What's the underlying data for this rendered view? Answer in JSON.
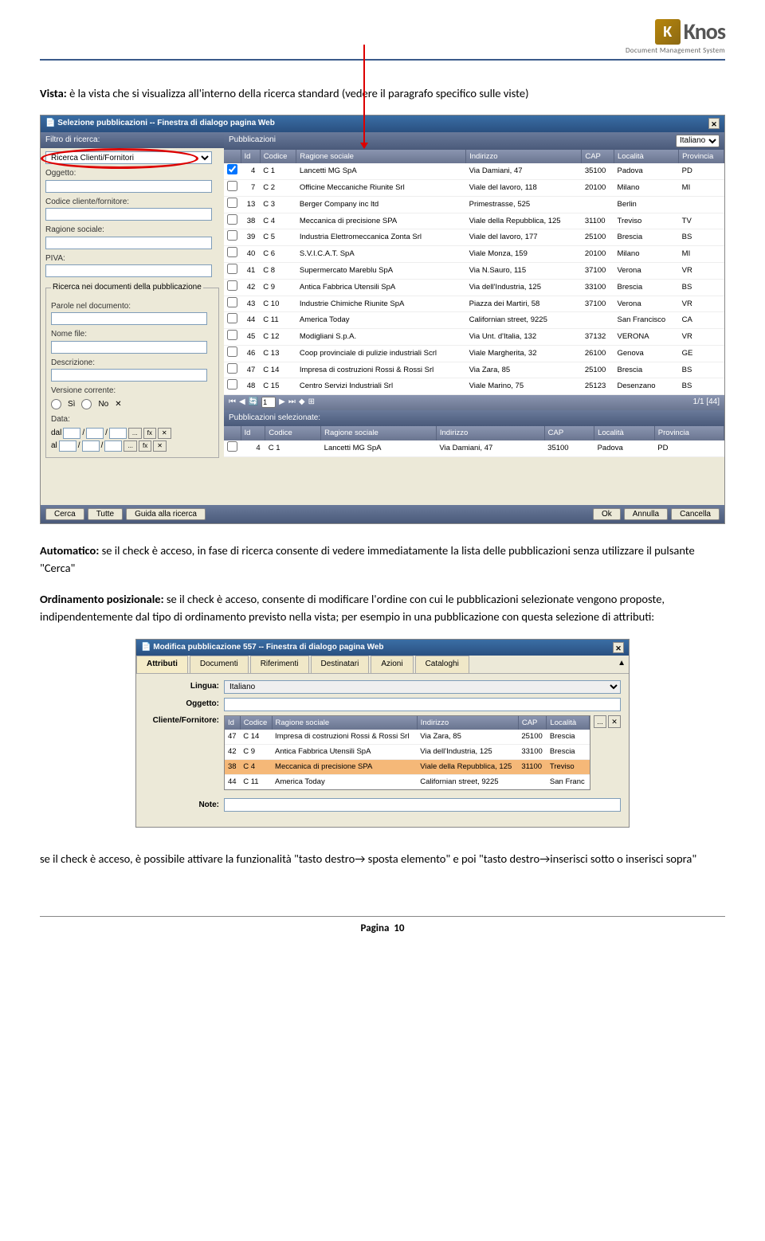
{
  "logo": {
    "brand": "Knos",
    "k": "K",
    "sub": "Document Management System"
  },
  "para1": {
    "label": "Vista:",
    "text": " è la vista che si visualizza all'interno della ricerca standard (vedere il paragrafo specifico sulle viste)"
  },
  "dlg1": {
    "title": "Selezione pubblicazioni -- Finestra di dialogo pagina Web",
    "filter_label": "Filtro di ricerca:",
    "dropdown_value": "Ricerca Clienti/Fornitori",
    "labels": {
      "oggetto": "Oggetto:",
      "codice": "Codice cliente/fornitore:",
      "ragione": "Ragione sociale:",
      "piva": "PIVA:",
      "fieldset": "Ricerca nei documenti della pubblicazione",
      "parole": "Parole nel documento:",
      "nomefile": "Nome file:",
      "descrizione": "Descrizione:",
      "versione": "Versione corrente:",
      "si": "Sì",
      "no": "No",
      "data": "Data:",
      "dal": "dal",
      "al": "al"
    },
    "pub_label": "Pubblicazioni",
    "lang_value": "Italiano",
    "columns": [
      "",
      "Id",
      "Codice",
      "Ragione sociale",
      "Indirizzo",
      "CAP",
      "Località",
      "Provincia"
    ],
    "rows": [
      {
        "chk": true,
        "id": "4",
        "cod": "C   1",
        "rag": "Lancetti MG SpA",
        "ind": "Via Damiani, 47",
        "cap": "35100",
        "loc": "Padova",
        "prov": "PD"
      },
      {
        "chk": false,
        "id": "7",
        "cod": "C   2",
        "rag": "Officine Meccaniche Riunite Srl",
        "ind": "Viale del lavoro, 118",
        "cap": "20100",
        "loc": "Milano",
        "prov": "MI"
      },
      {
        "chk": false,
        "id": "13",
        "cod": "C   3",
        "rag": "Berger Company inc ltd",
        "ind": "Primestrasse, 525",
        "cap": "",
        "loc": "Berlin",
        "prov": ""
      },
      {
        "chk": false,
        "id": "38",
        "cod": "C   4",
        "rag": "Meccanica di precisione SPA",
        "ind": "Viale della Repubblica, 125",
        "cap": "31100",
        "loc": "Treviso",
        "prov": "TV"
      },
      {
        "chk": false,
        "id": "39",
        "cod": "C   5",
        "rag": "Industria Elettromeccanica Zonta Srl",
        "ind": "Viale del lavoro, 177",
        "cap": "25100",
        "loc": "Brescia",
        "prov": "BS"
      },
      {
        "chk": false,
        "id": "40",
        "cod": "C   6",
        "rag": "S.V.I.C.A.T. SpA",
        "ind": "Viale Monza, 159",
        "cap": "20100",
        "loc": "Milano",
        "prov": "MI"
      },
      {
        "chk": false,
        "id": "41",
        "cod": "C   8",
        "rag": "Supermercato Mareblu SpA",
        "ind": "Via N.Sauro, 115",
        "cap": "37100",
        "loc": "Verona",
        "prov": "VR"
      },
      {
        "chk": false,
        "id": "42",
        "cod": "C   9",
        "rag": "Antica Fabbrica Utensili SpA",
        "ind": "Via dell'Industria, 125",
        "cap": "33100",
        "loc": "Brescia",
        "prov": "BS"
      },
      {
        "chk": false,
        "id": "43",
        "cod": "C   10",
        "rag": "Industrie Chimiche Riunite SpA",
        "ind": "Piazza dei Martiri, 58",
        "cap": "37100",
        "loc": "Verona",
        "prov": "VR"
      },
      {
        "chk": false,
        "id": "44",
        "cod": "C   11",
        "rag": "America Today",
        "ind": "Californian street, 9225",
        "cap": "",
        "loc": "San Francisco",
        "prov": "CA"
      },
      {
        "chk": false,
        "id": "45",
        "cod": "C   12",
        "rag": "Modigliani S.p.A.",
        "ind": "Via Unt. d'Italia, 132",
        "cap": "37132",
        "loc": "VERONA",
        "prov": "VR"
      },
      {
        "chk": false,
        "id": "46",
        "cod": "C   13",
        "rag": "Coop provinciale di pulizie industriali Scrl",
        "ind": "Viale Margherita, 32",
        "cap": "26100",
        "loc": "Genova",
        "prov": "GE"
      },
      {
        "chk": false,
        "id": "47",
        "cod": "C   14",
        "rag": "Impresa di costruzioni Rossi & Rossi Srl",
        "ind": "Via Zara, 85",
        "cap": "25100",
        "loc": "Brescia",
        "prov": "BS"
      },
      {
        "chk": false,
        "id": "48",
        "cod": "C   15",
        "rag": "Centro Servizi Industriali Srl",
        "ind": "Viale Marino, 75",
        "cap": "25123",
        "loc": "Desenzano",
        "prov": "BS"
      }
    ],
    "pager": {
      "page": "1",
      "info": "1/1 [44]"
    },
    "sel_label": "Pubblicazioni selezionate:",
    "sel_rows": [
      {
        "id": "4",
        "cod": "C   1",
        "rag": "Lancetti MG SpA",
        "ind": "Via Damiani, 47",
        "cap": "35100",
        "loc": "Padova",
        "prov": "PD"
      }
    ],
    "btns": {
      "cerca": "Cerca",
      "tutte": "Tutte",
      "guida": "Guida alla ricerca",
      "ok": "Ok",
      "annulla": "Annulla",
      "cancella": "Cancella"
    }
  },
  "para2": {
    "label": "Automatico:",
    "text": " se il check è acceso, in fase di ricerca consente di vedere immediatamente la lista delle pubblicazioni senza utilizzare il pulsante \"Cerca\""
  },
  "para3": {
    "label": "Ordinamento posizionale:",
    "text": " se il check è acceso, consente di modificare l'ordine con cui le pubblicazioni selezionate vengono proposte, indipendentemente dal tipo di ordinamento previsto nella vista; per esempio in una pubblicazione con questa selezione di attributi:"
  },
  "dlg2": {
    "title": "Modifica pubblicazione 557 -- Finestra di dialogo pagina Web",
    "tabs": [
      "Attributi",
      "Documenti",
      "Riferimenti",
      "Destinatari",
      "Azioni",
      "Cataloghi"
    ],
    "labels": {
      "lingua": "Lingua:",
      "oggetto": "Oggetto:",
      "cliente": "Cliente/Fornitore:",
      "note": "Note:"
    },
    "lingua_value": "Italiano",
    "columns": [
      "Id",
      "Codice",
      "Ragione sociale",
      "Indirizzo",
      "CAP",
      "Località"
    ],
    "rows": [
      {
        "sel": false,
        "id": "47",
        "cod": "C   14",
        "rag": "Impresa di costruzioni Rossi & Rossi Srl",
        "ind": "Via Zara, 85",
        "cap": "25100",
        "loc": "Brescia"
      },
      {
        "sel": false,
        "id": "42",
        "cod": "C   9",
        "rag": "Antica Fabbrica Utensili SpA",
        "ind": "Via dell'Industria, 125",
        "cap": "33100",
        "loc": "Brescia"
      },
      {
        "sel": true,
        "id": "38",
        "cod": "C   4",
        "rag": "Meccanica di precisione SPA",
        "ind": "Viale della Repubblica, 125",
        "cap": "31100",
        "loc": "Treviso"
      },
      {
        "sel": false,
        "id": "44",
        "cod": "C   11",
        "rag": "America Today",
        "ind": "Californian street, 9225",
        "cap": "",
        "loc": "San Franc"
      }
    ]
  },
  "para4": "se il check è acceso, è possibile attivare la funzionalità \"tasto destro→ sposta elemento\" e poi \"tasto destro→inserisci sotto o inserisci sopra\"",
  "footer": {
    "label": "Pagina",
    "num": "10"
  }
}
